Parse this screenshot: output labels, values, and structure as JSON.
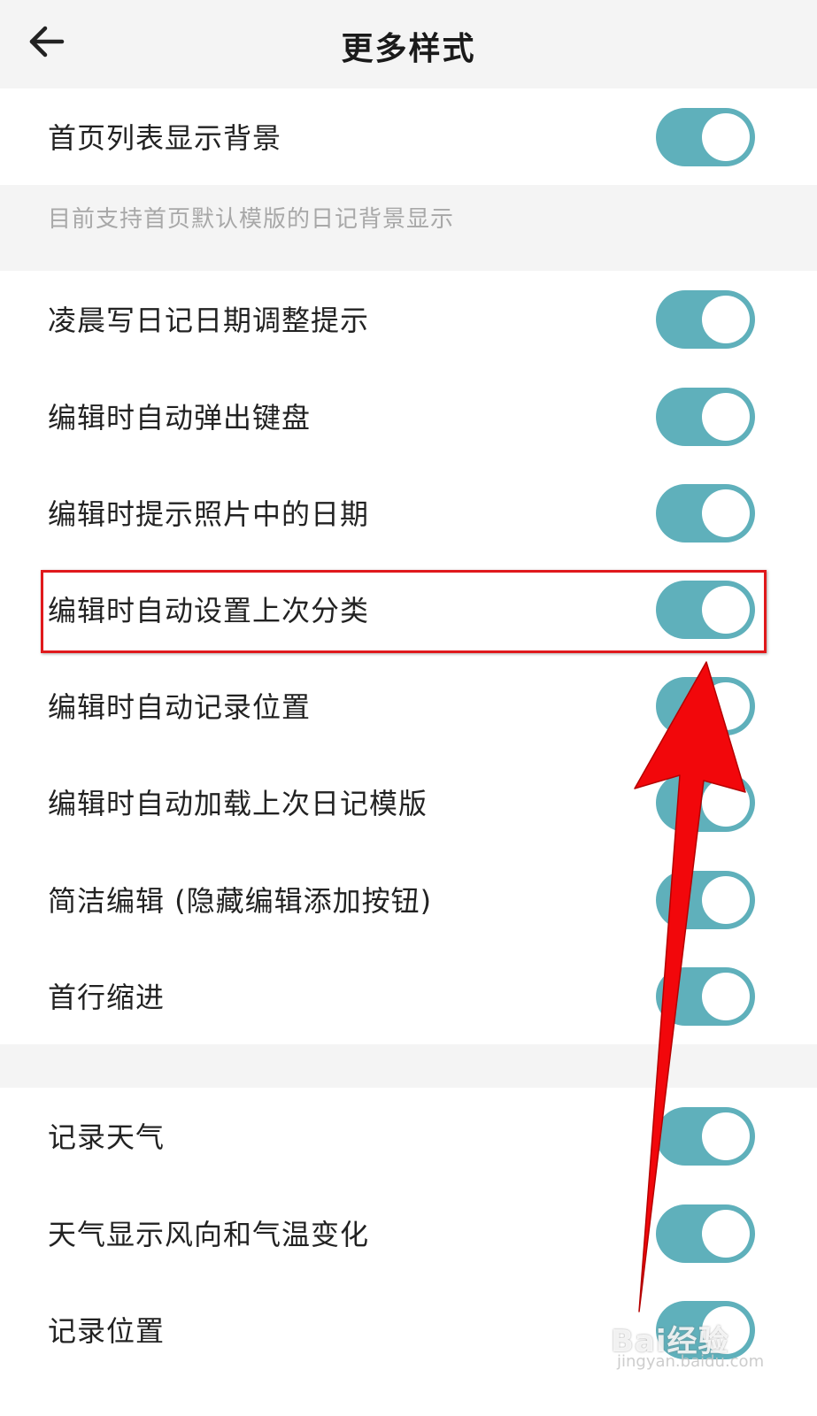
{
  "header": {
    "title": "更多样式",
    "back_icon": "arrow-left-icon"
  },
  "settings": {
    "homepage_background": {
      "label": "首页列表显示背景",
      "enabled": true
    },
    "homepage_background_note": "目前支持首页默认模版的日记背景显示",
    "items": [
      {
        "label": "凌晨写日记日期调整提示",
        "enabled": true
      },
      {
        "label": "编辑时自动弹出键盘",
        "enabled": true
      },
      {
        "label": "编辑时提示照片中的日期",
        "enabled": true
      },
      {
        "label": "编辑时自动设置上次分类",
        "enabled": true
      },
      {
        "label": "编辑时自动记录位置",
        "enabled": true
      },
      {
        "label": "编辑时自动加载上次日记模版",
        "enabled": true
      },
      {
        "label": "简洁编辑 (隐藏编辑添加按钮)",
        "enabled": true
      },
      {
        "label": "首行缩进",
        "enabled": true
      }
    ],
    "items2": [
      {
        "label": "记录天气",
        "enabled": true
      },
      {
        "label": "天气显示风向和气温变化",
        "enabled": true
      },
      {
        "label": "记录位置",
        "enabled": true
      }
    ]
  },
  "colors": {
    "toggle_on": "#5fb0bb",
    "highlight": "#e0191c",
    "arrow": "#f2070b"
  },
  "watermark": {
    "brand": "Bai经验",
    "url": "jingyan.baidu.com"
  }
}
